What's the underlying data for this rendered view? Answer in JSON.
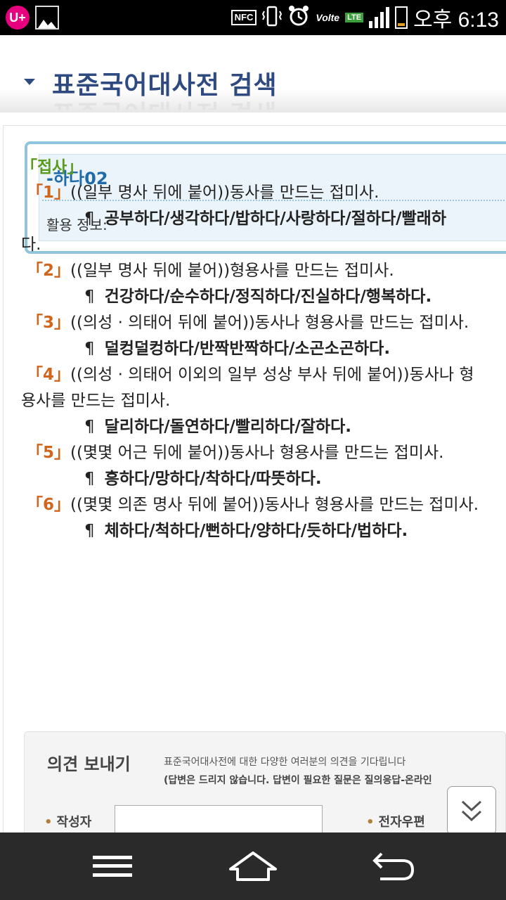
{
  "status_bar": {
    "carrier_icon": "U+",
    "nfc": "NFC",
    "volte": "Volte",
    "lte": "LTE",
    "clock": "오후 6:13",
    "icons": [
      "lg-uplus-icon",
      "gallery-icon",
      "nfc-icon",
      "vibrate-icon",
      "alarm-icon",
      "volte-icon",
      "lte-icon",
      "signal-icon",
      "battery-icon"
    ]
  },
  "header": {
    "title": "표준국어대사전 검색"
  },
  "entry": {
    "word": "-하다02",
    "info_label": "활용 정보:"
  },
  "part_of_speech": "「접사」",
  "definitions": [
    {
      "num": "「1」",
      "text": "((일부 명사 뒤에 붙어))동사를 만드는 접미사.",
      "example": "공부하다/생각하다/밥하다/사랑하다/절하다/빨래하",
      "example_cont": "다."
    },
    {
      "num": "「2」",
      "text": "((일부 명사 뒤에 붙어))형용사를 만드는 접미사.",
      "example": "건강하다/순수하다/정직하다/진실하다/행복하다."
    },
    {
      "num": "「3」",
      "text": "((의성 · 의태어 뒤에 붙어))동사나 형용사를 만드는 접미사.",
      "example": "덜컹덜컹하다/반짝반짝하다/소곤소곤하다."
    },
    {
      "num": "「4」",
      "text": "((의성 · 의태어 이외의 일부 성상 부사 뒤에 붙어))동사나 형",
      "text_cont": "용사를 만드는 접미사.",
      "example": "달리하다/돌연하다/빨리하다/잘하다."
    },
    {
      "num": "「5」",
      "text": "((몇몇 어근 뒤에 붙어))동사나 형용사를 만드는 접미사.",
      "example": "흥하다/망하다/착하다/따뜻하다."
    },
    {
      "num": "「6」",
      "text": "((몇몇 의존 명사 뒤에 붙어))동사나 형용사를 만드는 접미사.",
      "example": "체하다/척하다/뻔하다/양하다/듯하다/법하다."
    }
  ],
  "example_mark": "¶",
  "feedback": {
    "title": "의견 보내기",
    "desc1": "표준국어대사전에 대한 다양한 여러분의 의견을 기다립니다",
    "desc2": "(답변은 드리지 않습니다. 답변이 필요한 질문은 질의응답-온라인",
    "author_label": "작성자",
    "email_label": "전자우편",
    "author_value": ""
  },
  "colors": {
    "title": "#2e4a80",
    "entry_word": "#1f6aa8",
    "pos": "#5a9a1e",
    "def_num": "#d2651c"
  }
}
